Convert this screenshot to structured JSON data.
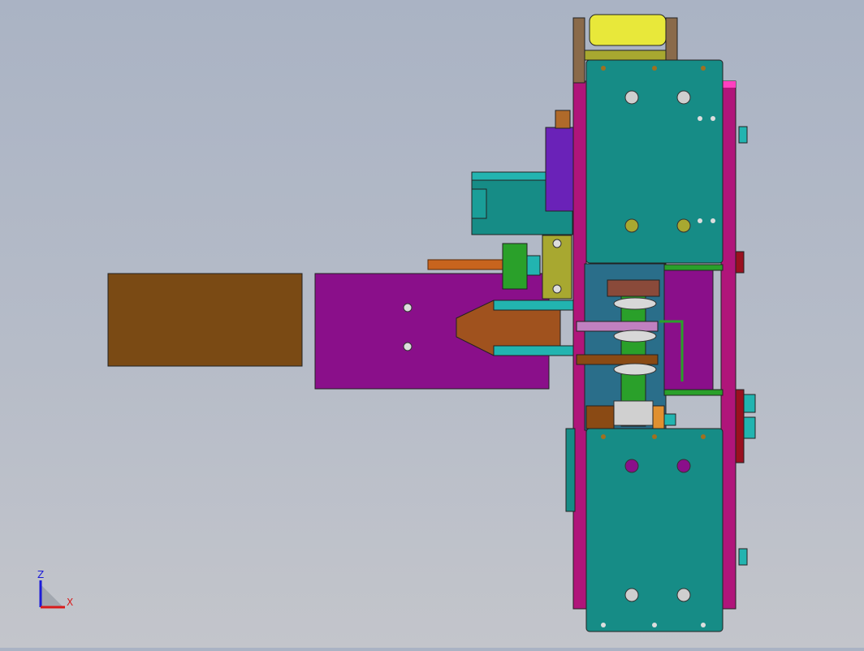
{
  "viewport": {
    "background_top": "#aab3c4",
    "background_bottom": "#c3c5cb"
  },
  "triad": {
    "x_label": "X",
    "z_label": "Z",
    "x_color": "#d81b1b",
    "z_color": "#1b1bd8"
  },
  "model_colors": {
    "brown_block": "#7a4a14",
    "purple_plate": "#8a0f8a",
    "teal_plate": "#168c86",
    "magenta_frame": "#b0157a",
    "olive": "#a8a830",
    "yellow_roller": "#e8e83a",
    "violet": "#6a22b8",
    "green_rod": "#2aa02a",
    "orange_rod": "#c8641e",
    "dark_red": "#9a1020"
  }
}
